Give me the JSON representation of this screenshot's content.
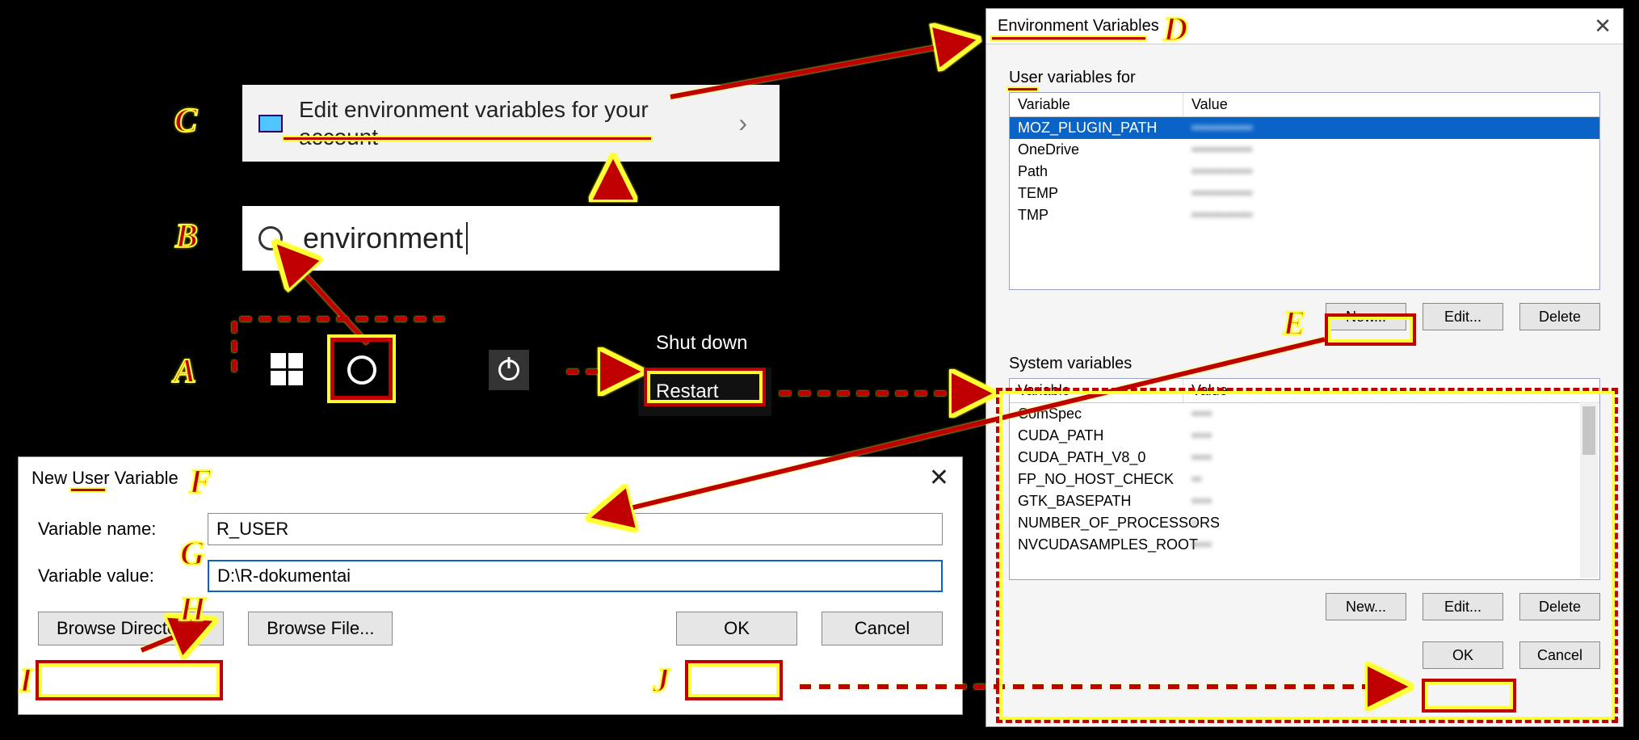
{
  "annotations": {
    "A": "A",
    "B": "B",
    "C": "C",
    "D": "D",
    "E": "E",
    "F": "F",
    "G": "G",
    "H": "H",
    "I": "I",
    "J": "J"
  },
  "search_result": {
    "text": "Edit environment variables for your account"
  },
  "search_bar": {
    "query": "environment"
  },
  "power_menu": {
    "shutdown": "Shut down",
    "restart": "Restart"
  },
  "env_dialog": {
    "title": "Environment Variables",
    "user_section_label": "User variables for",
    "system_section_label": "System variables",
    "col_variable": "Variable",
    "col_value": "Value",
    "user_vars": [
      {
        "name": "MOZ_PLUGIN_PATH",
        "value": "••••••••••••",
        "selected": true
      },
      {
        "name": "OneDrive",
        "value": "••••••••••••"
      },
      {
        "name": "Path",
        "value": "••••••••••••"
      },
      {
        "name": "TEMP",
        "value": "••••••••••••"
      },
      {
        "name": "TMP",
        "value": "••••••••••••"
      }
    ],
    "system_vars": [
      {
        "name": "ComSpec",
        "value": "••••"
      },
      {
        "name": "CUDA_PATH",
        "value": "••••"
      },
      {
        "name": "CUDA_PATH_V8_0",
        "value": "••••"
      },
      {
        "name": "FP_NO_HOST_CHECK",
        "value": "••"
      },
      {
        "name": "GTK_BASEPATH",
        "value": "••••"
      },
      {
        "name": "NUMBER_OF_PROCESSORS",
        "value": "•"
      },
      {
        "name": "NVCUDASAMPLES_ROOT",
        "value": "••••"
      }
    ],
    "buttons": {
      "new": "New...",
      "edit": "Edit...",
      "delete": "Delete",
      "ok": "OK",
      "cancel": "Cancel"
    }
  },
  "new_var_dialog": {
    "title": "New User Variable",
    "label_name": "Variable name:",
    "label_value": "Variable value:",
    "value_name": "R_USER",
    "value_value": "D:\\R-dokumentai",
    "buttons": {
      "browse_dir": "Browse Directory...",
      "browse_file": "Browse File...",
      "ok": "OK",
      "cancel": "Cancel"
    }
  }
}
